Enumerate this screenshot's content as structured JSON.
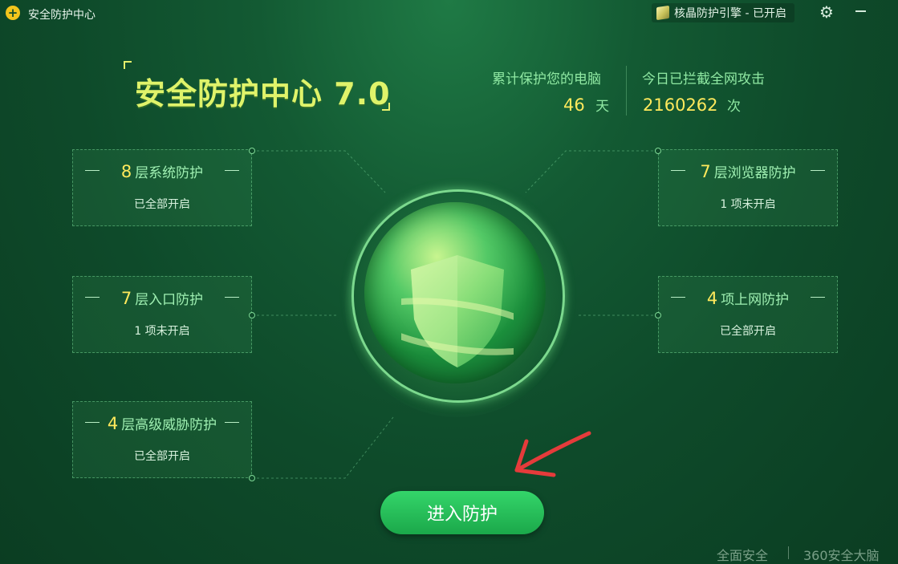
{
  "app": {
    "title": "安全防护中心",
    "logo_icon": "plus-logo-icon"
  },
  "header": {
    "engine_badge": "核晶防护引擎 - 已开启",
    "engine_icon": "cube-icon",
    "settings_icon": "gear-icon",
    "minimize_icon": "minimize-icon"
  },
  "brand": {
    "title": "安全防护中心 7.0"
  },
  "stats": {
    "days_label": "累计保护您的电脑",
    "days_value": "46",
    "days_unit": "天",
    "attacks_label": "今日已拦截全网攻击",
    "attacks_value": "2160262",
    "attacks_unit": "次"
  },
  "panels": [
    {
      "count": "8",
      "title": "层系统防护",
      "status": "已全部开启"
    },
    {
      "count": "7",
      "title": "层入口防护",
      "status": "1 项未开启"
    },
    {
      "count": "4",
      "title": "层高级威胁防护",
      "status": "已全部开启"
    },
    {
      "count": "7",
      "title": "层浏览器防护",
      "status": "1 项未开启"
    },
    {
      "count": "4",
      "title": "项上网防护",
      "status": "已全部开启"
    }
  ],
  "center": {
    "shield_icon": "shield-icon",
    "arrow_icon": "red-arrow-annotation"
  },
  "action": {
    "enter_label": "进入防护"
  },
  "footer": {
    "left": "全面安全",
    "right": "360安全大脑"
  },
  "colors": {
    "background": "#0e4a2a",
    "accent_yellow": "#ffe95c",
    "accent_green": "#34d56a",
    "text_green": "#9ff0b2",
    "annotation_red": "#e53b3b"
  }
}
